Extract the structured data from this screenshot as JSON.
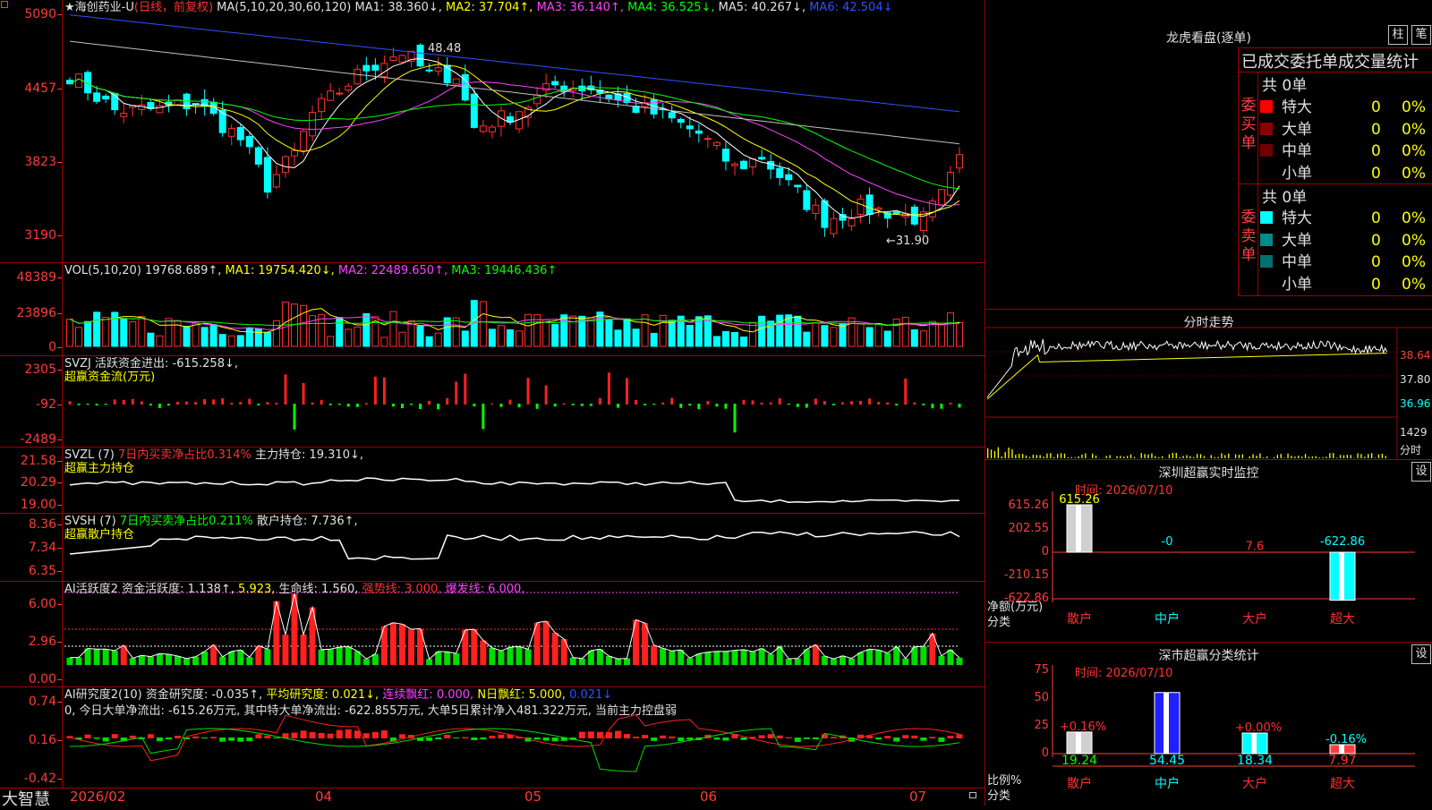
{
  "stock": {
    "star": "★",
    "name": "海创药业-U",
    "period": "(日线，前复权)"
  },
  "price": {
    "y_labels": [
      "5090",
      "4457",
      "3823",
      "3190"
    ],
    "ma_params": "MA(5,10,20,30,60,120)",
    "ma1": "MA1: 38.360↓,",
    "ma2": "MA2: 37.704↑,",
    "ma3": "MA3: 36.140↑,",
    "ma4": "MA4: 36.525↓,",
    "ma5": "MA5: 40.267↓,",
    "ma6": "MA6: 42.504↓",
    "high_label": "48.48",
    "low_label": "←31.90"
  },
  "volume": {
    "y_labels": [
      "48389",
      "23896",
      "0"
    ],
    "name": "VOL(5,10,20)",
    "value": "19768.689↑,",
    "ma1": "MA1: 19754.420↓,",
    "ma2": "MA2: 22489.650↑,",
    "ma3": "MA3: 19446.436↑"
  },
  "svzj": {
    "y_labels": [
      "2305",
      "-92",
      "-2489"
    ],
    "line1": "SVZJ  活跃资金进出: -615.258↓,",
    "line2": "超赢资金流(万元)"
  },
  "svzl": {
    "y_labels": [
      "21.58",
      "20.29",
      "19.00"
    ],
    "prefix": "SVZL (7)",
    "desc": "7日内买卖净占比0.314%",
    "tail": "主力持仓: 19.310↓,",
    "line2": "超赢主力持仓"
  },
  "svsh": {
    "y_labels": [
      "8.36",
      "7.34",
      "6.35"
    ],
    "prefix": "SVSH (7)",
    "desc": "7日内买卖净占比0.211%",
    "tail": "散户持仓: 7.736↑,",
    "line2": "超赢散户持仓"
  },
  "ai_active": {
    "y_labels": [
      "6.00",
      "2.96",
      "0.00"
    ],
    "name": "AI活跃度2",
    "v1": "资金活跃度: 1.138↑,",
    "v2": "5.923,",
    "v3": "生命线: 1.560,",
    "v4": "强势线: 3.000,",
    "v5": "爆发线: 6.000,"
  },
  "ai_research": {
    "y_labels": [
      "0.74",
      "0.16",
      "-0.42"
    ],
    "name": "AI研究度2(10)",
    "v1": "资金研究度: -0.035↑,",
    "v2": "平均研究度: 0.021↓,",
    "v3": "连续飘红: 0.000,",
    "v4": "N日飘红: 5.000,",
    "v5": "0.021↓",
    "line2": "0, 今日大单净流出: -615.26万元, 其中特大单净流出: -622.855万元, 大单5日累计净入481.322万元, 当前主力控盘弱"
  },
  "xaxis": {
    "labels": [
      "2026/02",
      "04",
      "05",
      "06",
      "07"
    ]
  },
  "footer": {
    "logo": "大智慧"
  },
  "right": {
    "lhb_title": "龙虎看盘(逐单)",
    "btn_zhu": "柱",
    "btn_bi": "笔",
    "stats_title": "已成交委托单成交量统计",
    "buy": {
      "side": "委买单",
      "count": "共 0单",
      "rows": [
        {
          "label": "特大",
          "color": "#ff0000",
          "v": "0",
          "p": "0%"
        },
        {
          "label": "大单",
          "color": "#8b0000",
          "v": "0",
          "p": "0%"
        },
        {
          "label": "中单",
          "color": "#700000",
          "v": "0",
          "p": "0%"
        },
        {
          "label": "小单",
          "color": "#000000",
          "v": "0",
          "p": "0%"
        }
      ]
    },
    "sell": {
      "side": "委卖单",
      "count": "共 0单",
      "rows": [
        {
          "label": "特大",
          "color": "#00ffff",
          "v": "0",
          "p": "0%"
        },
        {
          "label": "大单",
          "color": "#008b8b",
          "v": "0",
          "p": "0%"
        },
        {
          "label": "中单",
          "color": "#007070",
          "v": "0",
          "p": "0%"
        },
        {
          "label": "小单",
          "color": "#000000",
          "v": "0",
          "p": "0%"
        }
      ]
    },
    "intraday": {
      "title": "分时走势",
      "p1": "38.64",
      "p2": "37.80",
      "p3": "36.96",
      "vol": "1429",
      "vol_unit": "分时"
    },
    "monitor": {
      "title": "深圳超赢实时监控",
      "btn": "设",
      "time": "时间: 2026/07/10",
      "y_labels": [
        "615.26",
        "202.55",
        "0",
        "-210.15",
        "-622.86"
      ],
      "unit1": "净额(万元)",
      "unit2": "分类",
      "values": [
        {
          "cat": "散户",
          "v": 615.26,
          "label": "615.26"
        },
        {
          "cat": "中户",
          "v": -0.0,
          "label": "-0"
        },
        {
          "cat": "大户",
          "v": 7.6,
          "label": "7.6"
        },
        {
          "cat": "超大",
          "v": -622.86,
          "label": "-622.86"
        }
      ]
    },
    "classify": {
      "title": "深市超赢分类统计",
      "btn": "设",
      "time": "时间: 2026/07/10",
      "y_labels": [
        "75",
        "50",
        "25",
        "0"
      ],
      "unit1": "比例%",
      "unit2": "分类",
      "values": [
        {
          "cat": "散户",
          "v": 19.24,
          "label": "19.24",
          "chg": "+0.16%"
        },
        {
          "cat": "中户",
          "v": 54.45,
          "label": "54.45",
          "chg": ""
        },
        {
          "cat": "大户",
          "v": 18.34,
          "label": "18.34",
          "chg": "+0.00%"
        },
        {
          "cat": "超大",
          "v": 7.97,
          "label": "7.97",
          "chg": "-0.16%"
        }
      ]
    }
  },
  "colors": {
    "up": "#ff3030",
    "down": "#00ffff",
    "grid": "#a00000",
    "ma1": "#ffffff",
    "ma2": "#ffff00",
    "ma3": "#ff40ff",
    "ma4": "#00ff00",
    "ma5": "#c0c0c0",
    "ma6": "#3050ff"
  }
}
